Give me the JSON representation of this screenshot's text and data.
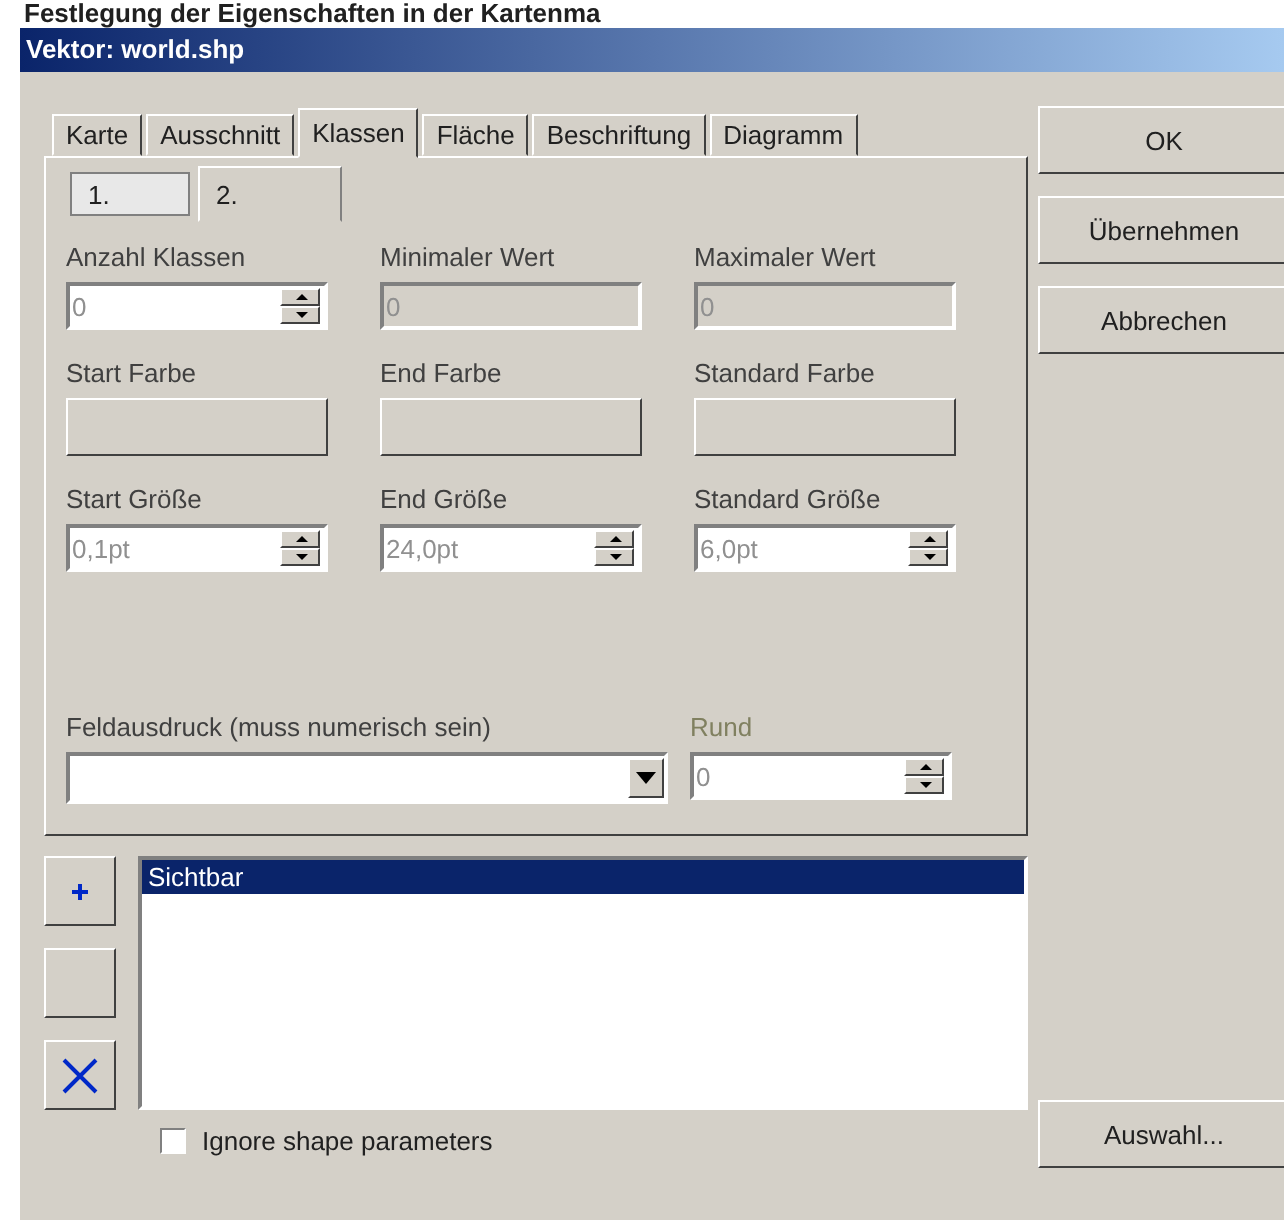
{
  "heading": "Festlegung der Eigenschaften in der Kartenma",
  "window": {
    "title": "Vektor: world.shp"
  },
  "tabs": [
    {
      "label": "Karte",
      "selected": false
    },
    {
      "label": "Ausschnitt",
      "selected": false
    },
    {
      "label": "Klassen",
      "selected": true
    },
    {
      "label": "Fläche",
      "selected": false
    },
    {
      "label": "Beschriftung",
      "selected": false
    },
    {
      "label": "Diagramm",
      "selected": false
    }
  ],
  "subtabs": [
    {
      "label": "1.",
      "selected": true
    },
    {
      "label": "2.",
      "selected": false
    }
  ],
  "fields": [
    {
      "kind": "spin",
      "label": "Anzahl Klassen",
      "value": "0",
      "disabled": false
    },
    {
      "kind": "text",
      "label": "Minimaler Wert",
      "value": "0",
      "disabled": true
    },
    {
      "kind": "text",
      "label": "Maximaler Wert",
      "value": "0",
      "disabled": true
    },
    {
      "kind": "color",
      "label": "Start Farbe"
    },
    {
      "kind": "color",
      "label": "End Farbe"
    },
    {
      "kind": "color",
      "label": "Standard Farbe"
    },
    {
      "kind": "spin",
      "label": "Start Größe",
      "value": "0,1pt",
      "disabled": false
    },
    {
      "kind": "spin",
      "label": "End Größe",
      "value": "24,0pt",
      "disabled": false
    },
    {
      "kind": "spin",
      "label": "Standard Größe",
      "value": "6,0pt",
      "disabled": false
    }
  ],
  "expression": {
    "label": "Feldausdruck (muss numerisch sein)"
  },
  "round": {
    "label": "Rund",
    "value": "0",
    "disabled": true
  },
  "list": {
    "items": [
      {
        "label": "Sichtbar",
        "selected": true
      }
    ]
  },
  "ignore_shape": {
    "label": "Ignore shape parameters",
    "checked": false
  },
  "buttons": [
    "OK",
    "Übernehmen",
    "Abbrechen"
  ],
  "select_button": "Auswahl..."
}
